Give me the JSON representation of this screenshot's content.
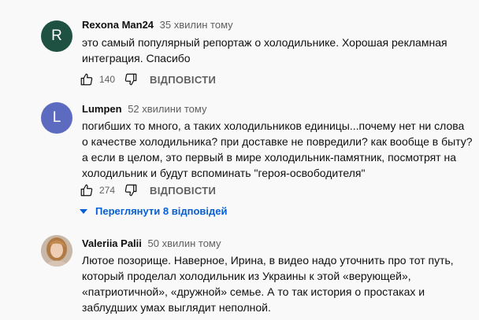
{
  "comments": [
    {
      "avatar_letter": "R",
      "avatar_color": "#1f5143",
      "author": "Rexona Man24",
      "time": "35 хвилин тому",
      "text": "это самый популярный репортаж о холодильнике. Хорошая рекламная интеграция. Спасибо",
      "likes": "140",
      "reply_label": "ВІДПОВІСТИ"
    },
    {
      "avatar_letter": "L",
      "avatar_color": "#5c6bc0",
      "author": "Lumpen",
      "time": "52 хвилини тому",
      "text": "погибших то много, а таких холодильников единицы...почему нет ни слова о качестве холодильника? при доставке не повредили? как вообще в быту? а если в целом, это первый в мире холодильник-памятник, посмотрят на холодильник и будут вспоминать \"героя-освободителя\"",
      "likes": "274",
      "reply_label": "ВІДПОВІСТИ",
      "replies_toggle": "Переглянути 8 відповідей"
    },
    {
      "avatar_letter": "",
      "author": "Valeriia Palii",
      "time": "50 хвилин тому",
      "text": "Лютое позорище. Наверное, Ирина, в видео надо уточнить про тот путь, который проделал холодильник из Украины к этой «верующей», «патриотичной», «дружной» семье. А то так история о простаках и заблудших умах выглядит неполной."
    }
  ],
  "icons": {
    "like": "thumbs-up-icon",
    "dislike": "thumbs-down-icon",
    "expand": "caret-down-icon"
  },
  "colors": {
    "link_blue": "#065fd4",
    "secondary_text": "#606060",
    "background": "#f9f9f9"
  }
}
